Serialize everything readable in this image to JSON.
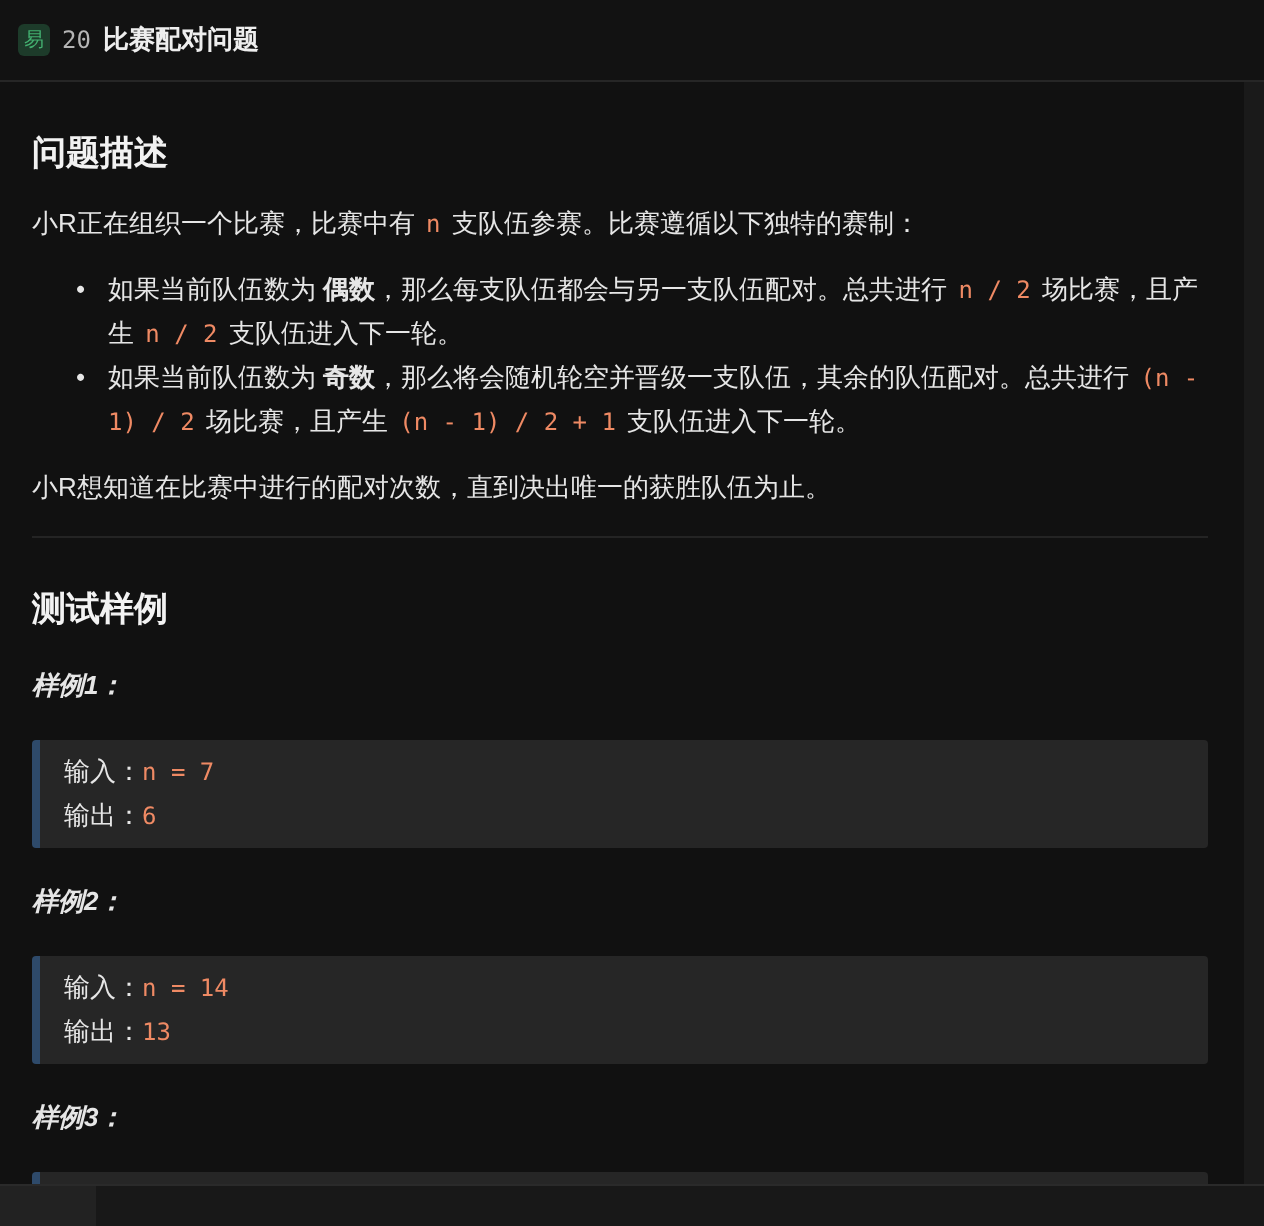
{
  "header": {
    "difficulty": "易",
    "number": "20",
    "title": "比赛配对问题"
  },
  "description": {
    "heading": "问题描述",
    "intro": [
      {
        "kind": "text",
        "text": "小R正在组织一个比赛，比赛中有 "
      },
      {
        "kind": "code",
        "text": "n"
      },
      {
        "kind": "text",
        "text": " 支队伍参赛。比赛遵循以下独特的赛制："
      }
    ],
    "rules": [
      {
        "marker": "•",
        "segments": [
          {
            "kind": "text",
            "text": "如果当前队伍数为 **偶数**，那么每支队伍都会与另一支队伍配对。总共进行 "
          },
          {
            "kind": "code",
            "text": "n / 2"
          },
          {
            "kind": "text",
            "text": " 场比赛，且产生 "
          },
          {
            "kind": "code",
            "text": "n / 2"
          },
          {
            "kind": "text",
            "text": " 支队伍进入下一轮。"
          }
        ]
      },
      {
        "marker": "•",
        "segments": [
          {
            "kind": "text",
            "text": "如果当前队伍数为 **奇数**，那么将会随机轮空并晋级一支队伍，其余的队伍配对。总共进行 "
          },
          {
            "kind": "code",
            "text": "(n - 1) / 2"
          },
          {
            "kind": "text",
            "text": " 场比赛，且产生 "
          },
          {
            "kind": "code",
            "text": "(n - 1) / 2 + 1"
          },
          {
            "kind": "text",
            "text": " 支队伍进入下一轮。"
          }
        ]
      }
    ],
    "outro": [
      {
        "kind": "text",
        "text": "小R想知道在比赛中进行的配对次数，直到决出唯一的获胜队伍为止。"
      }
    ]
  },
  "samples": {
    "heading": "测试样例",
    "items": [
      {
        "label": "样例1：",
        "lines": [
          {
            "name": "输入：",
            "value": "n = 7"
          },
          {
            "name": "输出：",
            "value": "6"
          }
        ]
      },
      {
        "label": "样例2：",
        "lines": [
          {
            "name": "输入：",
            "value": "n = 14"
          },
          {
            "name": "输出：",
            "value": "13"
          }
        ]
      },
      {
        "label": "样例3："
      }
    ]
  }
}
